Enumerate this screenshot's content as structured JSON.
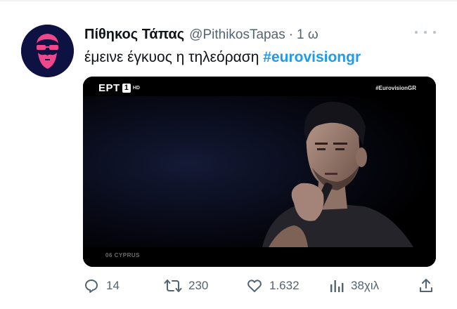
{
  "author": {
    "display_name": "Πίθηκος Τάπας",
    "handle": "@PithikosTapas",
    "separator": "·",
    "time": "1 ω"
  },
  "tweet": {
    "text": "έμεινε έγκυος η τηλεόραση",
    "hashtag": "#eurovisiongr"
  },
  "media": {
    "channel_logo": "ΕΡΤ",
    "channel_number": "1",
    "channel_hd": "HD",
    "broadcast_tag": "#EurovisionGR",
    "country_caption": "06 CYPRUS"
  },
  "actions": {
    "replies": "14",
    "retweets": "230",
    "likes": "1.632",
    "views": "38χιλ"
  },
  "icons": {
    "avatar": "bearded-face-with-sunglasses",
    "more": "more-dots-icon",
    "reply": "reply-icon",
    "retweet": "retweet-icon",
    "like": "heart-icon",
    "views": "analytics-icon",
    "share": "share-icon"
  },
  "colors": {
    "link": "#1d9bf0",
    "muted": "#536471",
    "avatar_bg": "#0d1242",
    "avatar_fg": "#f0468c"
  }
}
